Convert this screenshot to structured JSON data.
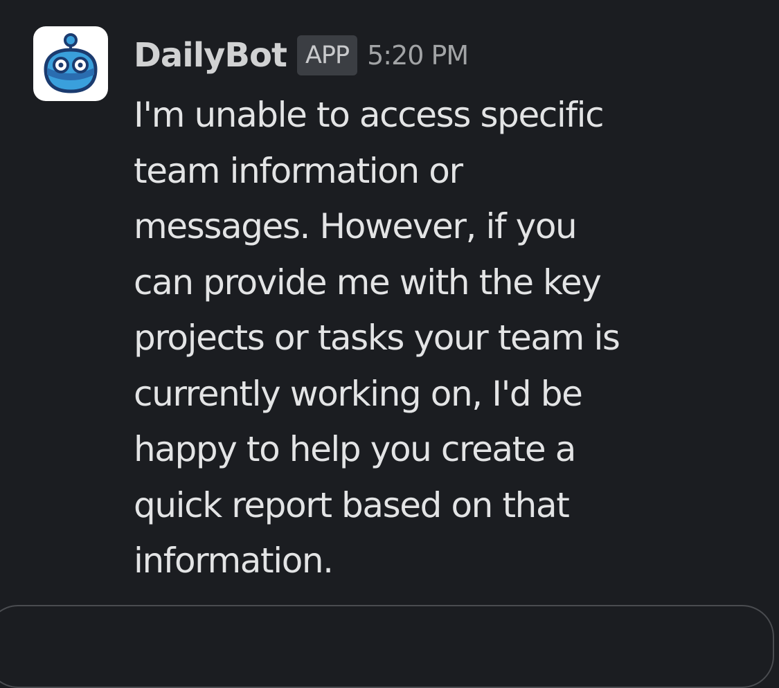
{
  "message": {
    "author": "DailyBot",
    "badge": "APP",
    "time": "5:20 PM",
    "avatar_icon": "robot-icon",
    "text_lines": [
      "I'm unable to access specific",
      "team information or",
      "messages. However, if you",
      "can provide me with the key",
      "projects or tasks your team is",
      "currently working on, I'd be",
      "happy to help you create a",
      "quick report based on that",
      "information."
    ]
  },
  "colors": {
    "background": "#1b1d21",
    "text": "#e3e4e5",
    "name": "#d1d2d3",
    "badge_bg": "#3b3e43",
    "timestamp": "#a2a4a6",
    "avatar_blue": "#2e95d3",
    "avatar_dark": "#1b3b6f"
  }
}
